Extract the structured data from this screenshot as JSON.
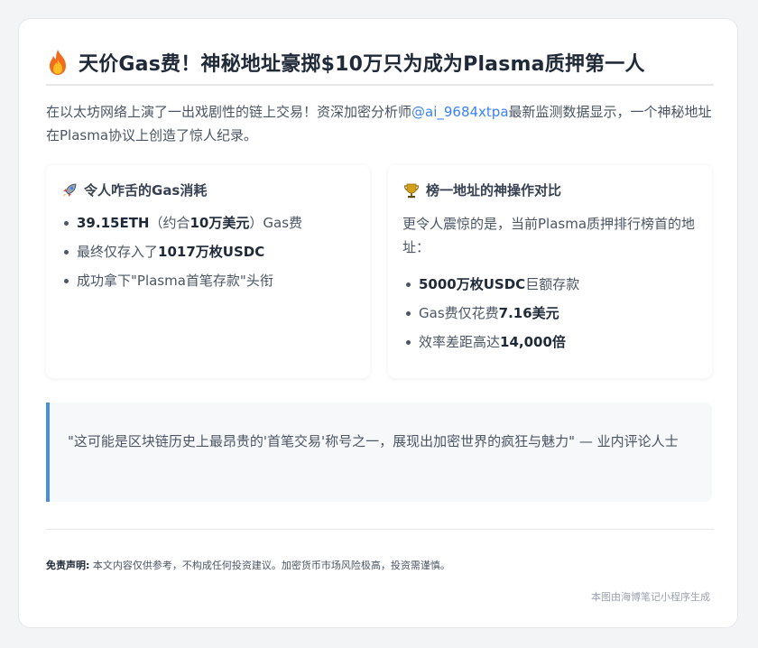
{
  "header": {
    "title": "天价Gas费！神秘地址豪掷$10万只为成为Plasma质押第一人",
    "icon": "fire-icon"
  },
  "intro": {
    "before": "在以太坊网络上演了一出戏剧性的链上交易！资深加密分析师",
    "handle": "@ai_9684xtpa",
    "after": "最新监测数据显示，一个神秘地址在Plasma协议上创造了惊人纪录。"
  },
  "gas_box": {
    "icon": "rocket-icon",
    "title": "令人咋舌的Gas消耗",
    "items": [
      {
        "b1": "39.15ETH",
        "t1": "（约合",
        "b2": "10万美元",
        "t2": "）Gas费"
      },
      {
        "t1": "最终仅存入了",
        "b1": "1017万枚USDC"
      },
      {
        "t1": "成功拿下\"Plasma首笔存款\"头衔"
      }
    ]
  },
  "top_box": {
    "icon": "trophy-icon",
    "title": "榜一地址的神操作对比",
    "text": "更令人震惊的是，当前Plasma质押排行榜首的地址：",
    "items": [
      {
        "b1": "5000万枚USDC",
        "t1": "巨额存款"
      },
      {
        "t1": "Gas费仅花费",
        "b1": "7.16美元"
      },
      {
        "t1": "效率差距高达",
        "b1": "14,000倍"
      }
    ]
  },
  "quote": {
    "text": "\"这可能是区块链历史上最昂贵的'首笔交易'称号之一，展现出加密世界的疯狂与魅力\" — 业内评论人士"
  },
  "footer": {
    "disclaimer_label": "免责声明:",
    "disclaimer_text": " 本文内容仅供参考，不构成任何投资建议。加密货币市场风险极高，投资需谨慎。",
    "credit": "本图由海博笔记小程序生成"
  },
  "colors": {
    "accent": "#4a90d9",
    "link": "#3b82f6"
  }
}
